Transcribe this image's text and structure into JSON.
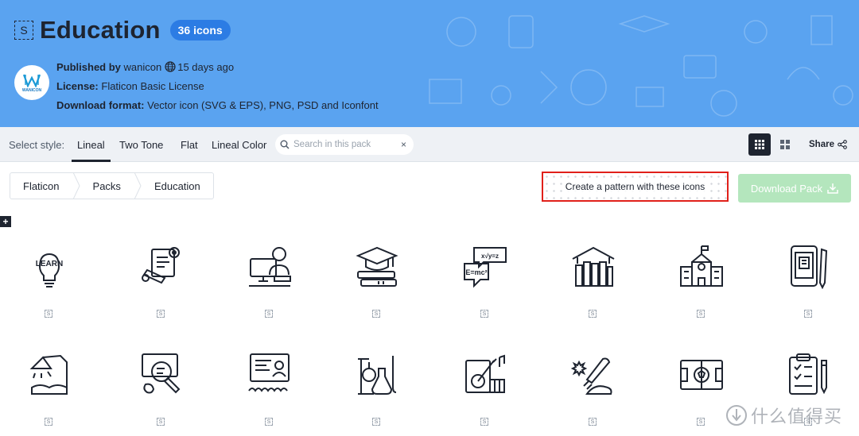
{
  "header": {
    "style_square": "S",
    "title": "Education",
    "icons_badge": "36 icons",
    "avatar_label": "WANICON",
    "published_label": "Published by",
    "publisher": "wanicon",
    "published_ago": "15 days ago",
    "license_label": "License:",
    "license_value": "Flaticon Basic License",
    "format_label": "Download format:",
    "format_value": "Vector icon (SVG & EPS), PNG, PSD and Iconfont",
    "bg_color": "#5aa3f0",
    "badge_color": "#2c7ce4"
  },
  "style_bar": {
    "label": "Select style:",
    "tabs": [
      {
        "label": "Lineal",
        "active": true
      },
      {
        "label": "Two Tone",
        "active": false
      },
      {
        "label": "Flat",
        "active": false
      },
      {
        "label": "Lineal Color",
        "active": false
      }
    ],
    "search_placeholder": "Search in this pack",
    "clear": "×",
    "share_label": "Share"
  },
  "breadcrumb": [
    "Flaticon",
    "Packs",
    "Education"
  ],
  "actions": {
    "pattern_label": "Create a pattern with these icons",
    "download_label": "Download Pack",
    "plus": "+",
    "highlight_color": "#e0201a",
    "download_color": "#b4e6bd"
  },
  "icons": [
    {
      "name": "learn-bulb-icon",
      "text": "LEARN",
      "style": "S"
    },
    {
      "name": "diploma-gear-icon",
      "style": "S"
    },
    {
      "name": "online-teacher-icon",
      "style": "S"
    },
    {
      "name": "graduation-cap-books-icon",
      "style": "S"
    },
    {
      "name": "formula-speech-icon",
      "text1": "x√y=z",
      "text2": "E=mc²",
      "style": "S"
    },
    {
      "name": "library-books-icon",
      "style": "S"
    },
    {
      "name": "school-building-icon",
      "style": "S"
    },
    {
      "name": "ebook-tablet-icon",
      "style": "S"
    },
    {
      "name": "desk-lamp-icon",
      "style": "S"
    },
    {
      "name": "research-magnifier-icon",
      "style": "S"
    },
    {
      "name": "online-class-icon",
      "style": "S"
    },
    {
      "name": "chemistry-lab-icon",
      "style": "S"
    },
    {
      "name": "music-guitar-icon",
      "style": "S"
    },
    {
      "name": "space-rocket-icon",
      "style": "S"
    },
    {
      "name": "football-field-icon",
      "style": "S"
    },
    {
      "name": "clipboard-pencil-icon",
      "style": "S"
    }
  ],
  "watermark": "什么值得买"
}
